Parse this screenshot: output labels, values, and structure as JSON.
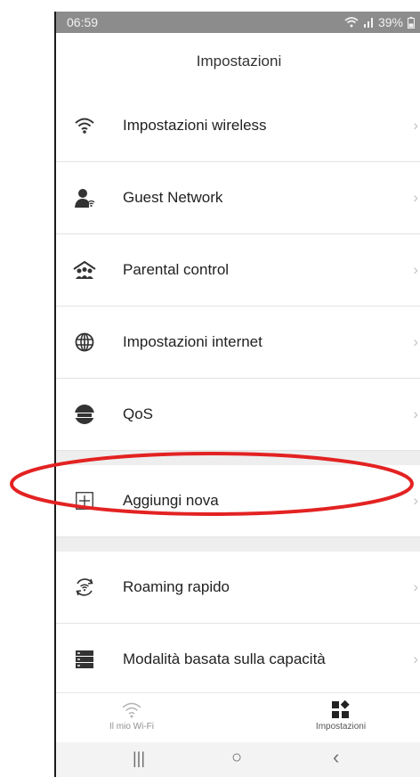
{
  "status": {
    "time": "06:59",
    "battery": "39%"
  },
  "header": {
    "title": "Impostazioni"
  },
  "items": [
    {
      "label": "Impostazioni wireless",
      "icon": "wifi-icon"
    },
    {
      "label": "Guest Network",
      "icon": "guest-user-icon"
    },
    {
      "label": "Parental control",
      "icon": "family-icon"
    },
    {
      "label": "Impostazioni internet",
      "icon": "globe-icon"
    },
    {
      "label": "QoS",
      "icon": "qos-icon"
    },
    {
      "label": "Aggiungi nova",
      "icon": "plus-box-icon"
    },
    {
      "label": "Roaming rapido",
      "icon": "roaming-icon"
    },
    {
      "label": "Modalità basata sulla capacità",
      "icon": "server-icon"
    }
  ],
  "tabs": [
    {
      "label": "Il mio Wi-Fi",
      "icon": "wifi-icon"
    },
    {
      "label": "Impostazioni",
      "icon": "settings-grid-icon"
    }
  ],
  "chevron": "›",
  "nav": {
    "recent": "|||",
    "home": "○",
    "back": "‹"
  },
  "colors": {
    "annotation": "#e32222",
    "statusbar": "#8c8c8c"
  }
}
